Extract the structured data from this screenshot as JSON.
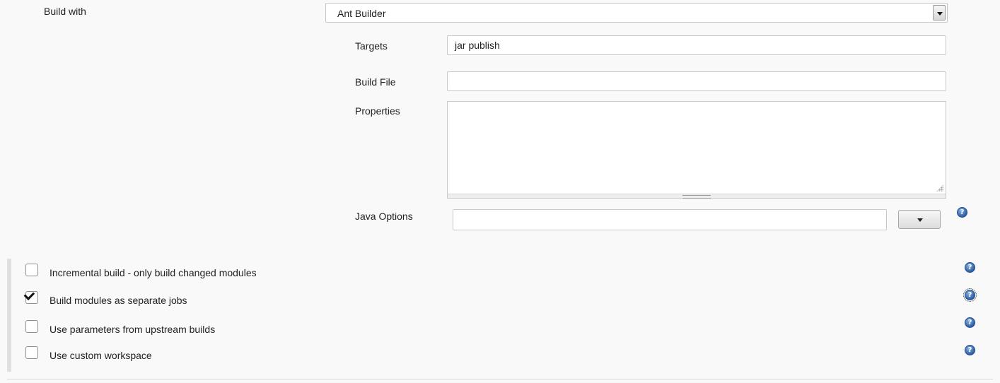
{
  "build_with": {
    "label": "Build with",
    "selected": "Ant Builder"
  },
  "ant": {
    "targets_label": "Targets",
    "targets_value": "jar publish",
    "build_file_label": "Build File",
    "build_file_value": "",
    "properties_label": "Properties",
    "properties_value": "",
    "java_options_label": "Java Options",
    "java_options_value": ""
  },
  "options": [
    {
      "label": "Incremental build - only build changed modules",
      "checked": false
    },
    {
      "label": "Build modules as separate jobs",
      "checked": true
    },
    {
      "label": "Use parameters from upstream builds",
      "checked": false
    },
    {
      "label": "Use custom workspace",
      "checked": false
    }
  ],
  "help_glyph": "?",
  "icons": {
    "help": "help-icon",
    "dropdown": "chevron-down-icon"
  },
  "colors": {
    "help_blue": "#2d5ea5",
    "background": "#f9f9f9"
  }
}
